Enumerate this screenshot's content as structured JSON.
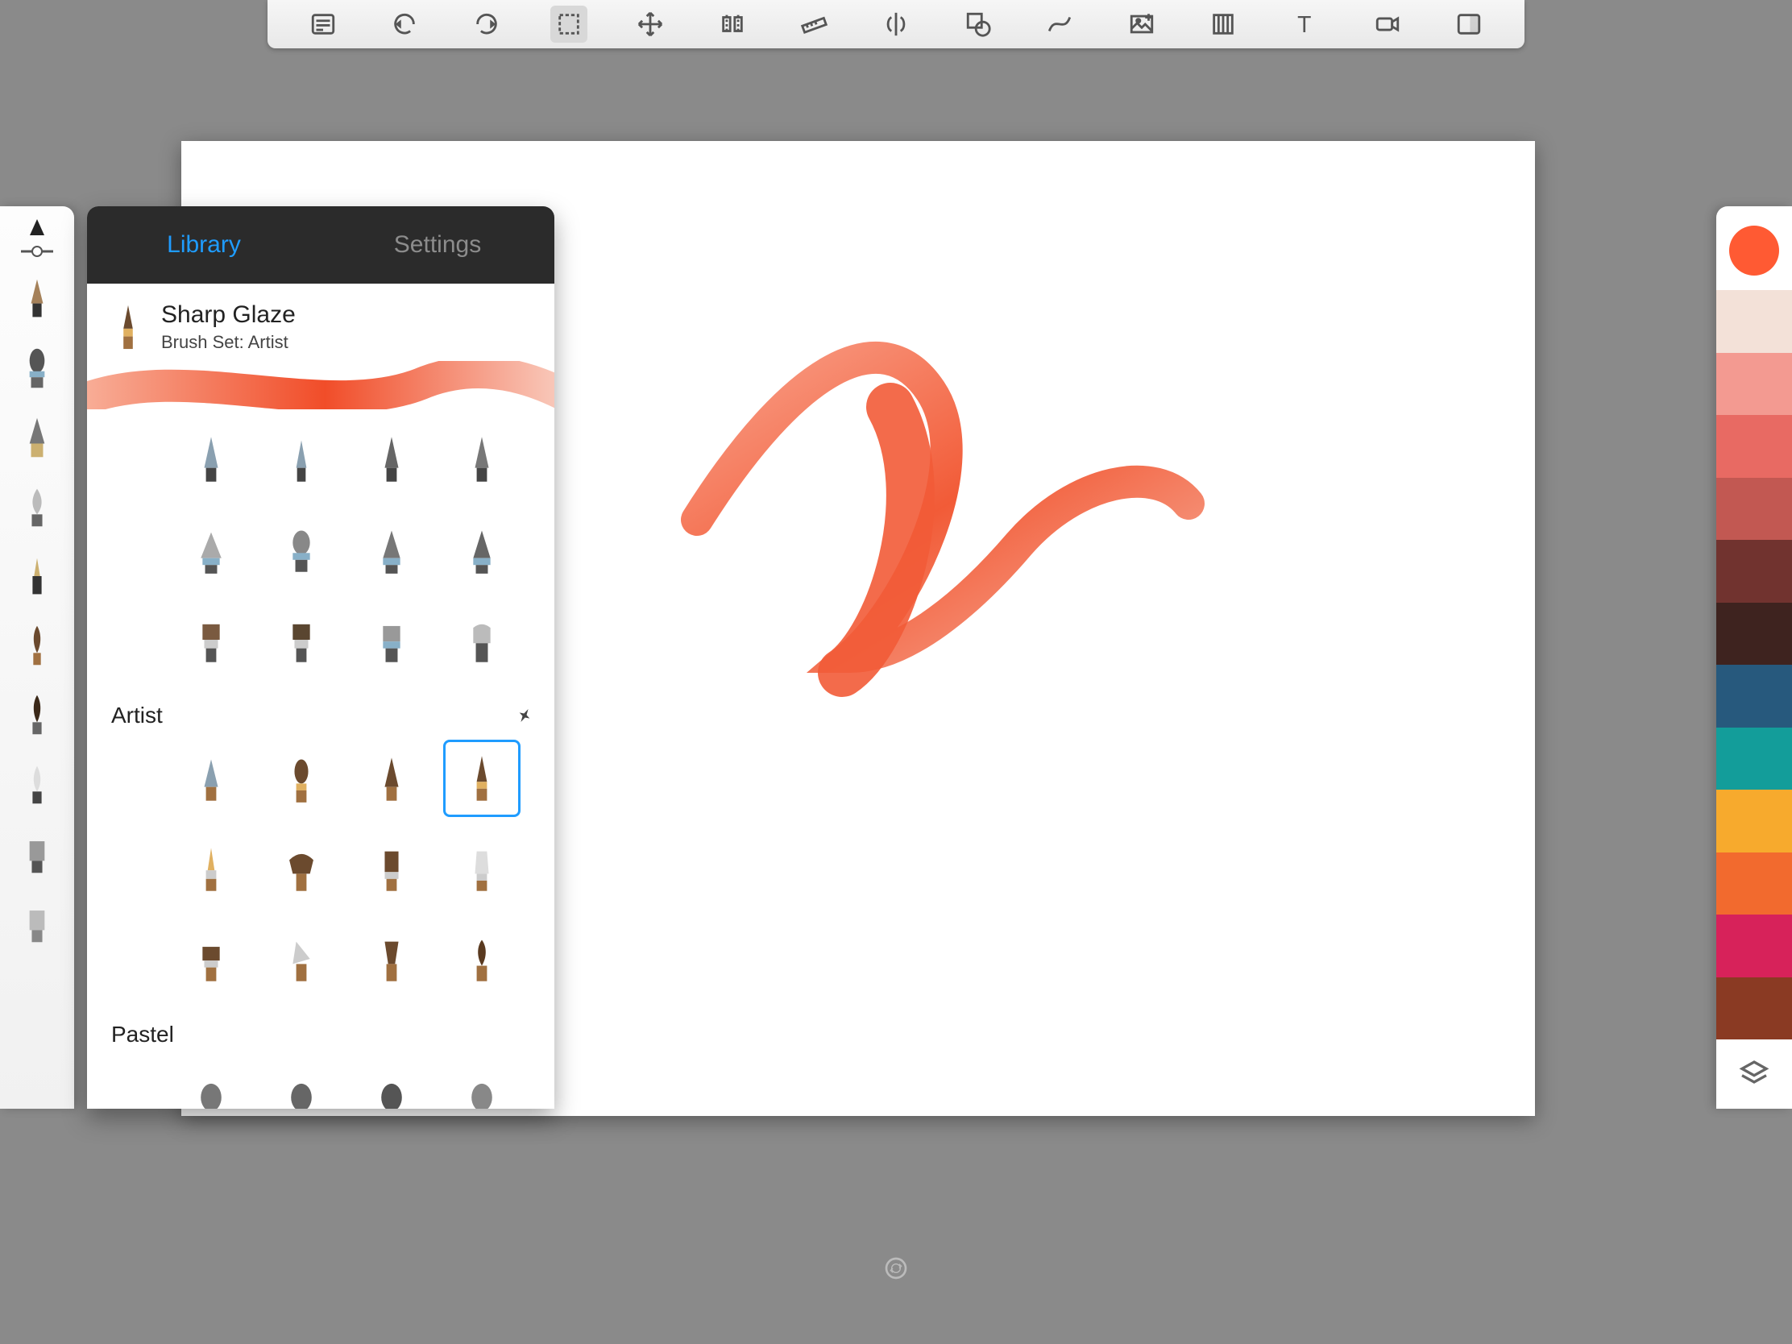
{
  "toolbar": {
    "items": [
      {
        "name": "list-icon"
      },
      {
        "name": "undo-icon"
      },
      {
        "name": "redo-icon"
      },
      {
        "name": "select-icon",
        "selected": true
      },
      {
        "name": "move-icon"
      },
      {
        "name": "flip-icon"
      },
      {
        "name": "ruler-icon"
      },
      {
        "name": "mirror-icon"
      },
      {
        "name": "shape-icon"
      },
      {
        "name": "curve-icon"
      },
      {
        "name": "image-icon"
      },
      {
        "name": "perspective-icon"
      },
      {
        "name": "text-icon"
      },
      {
        "name": "record-icon"
      },
      {
        "name": "fullscreen-icon"
      }
    ]
  },
  "panel": {
    "tabs": {
      "library": "Library",
      "settings": "Settings",
      "active": "library"
    },
    "brush_name": "Sharp Glaze",
    "brush_set_prefix": "Brush Set: ",
    "brush_set": "Artist",
    "sections": [
      {
        "label": "",
        "rows": [
          5,
          5,
          4
        ]
      },
      {
        "label": "Artist",
        "pinned": true,
        "rows": [
          5,
          5,
          5
        ],
        "selected_index": 3
      },
      {
        "label": "Pastel",
        "rows": [
          5
        ]
      }
    ]
  },
  "color_rail": {
    "current": "#ff5a33",
    "swatches": [
      "#f3e1d8",
      "#f39a91",
      "#e86a63",
      "#c25852",
      "#71332f",
      "#3e231f",
      "#27597d",
      "#139d9a",
      "#f7aa2d",
      "#f26a2e",
      "#d7225a",
      "#8a3a23"
    ]
  }
}
